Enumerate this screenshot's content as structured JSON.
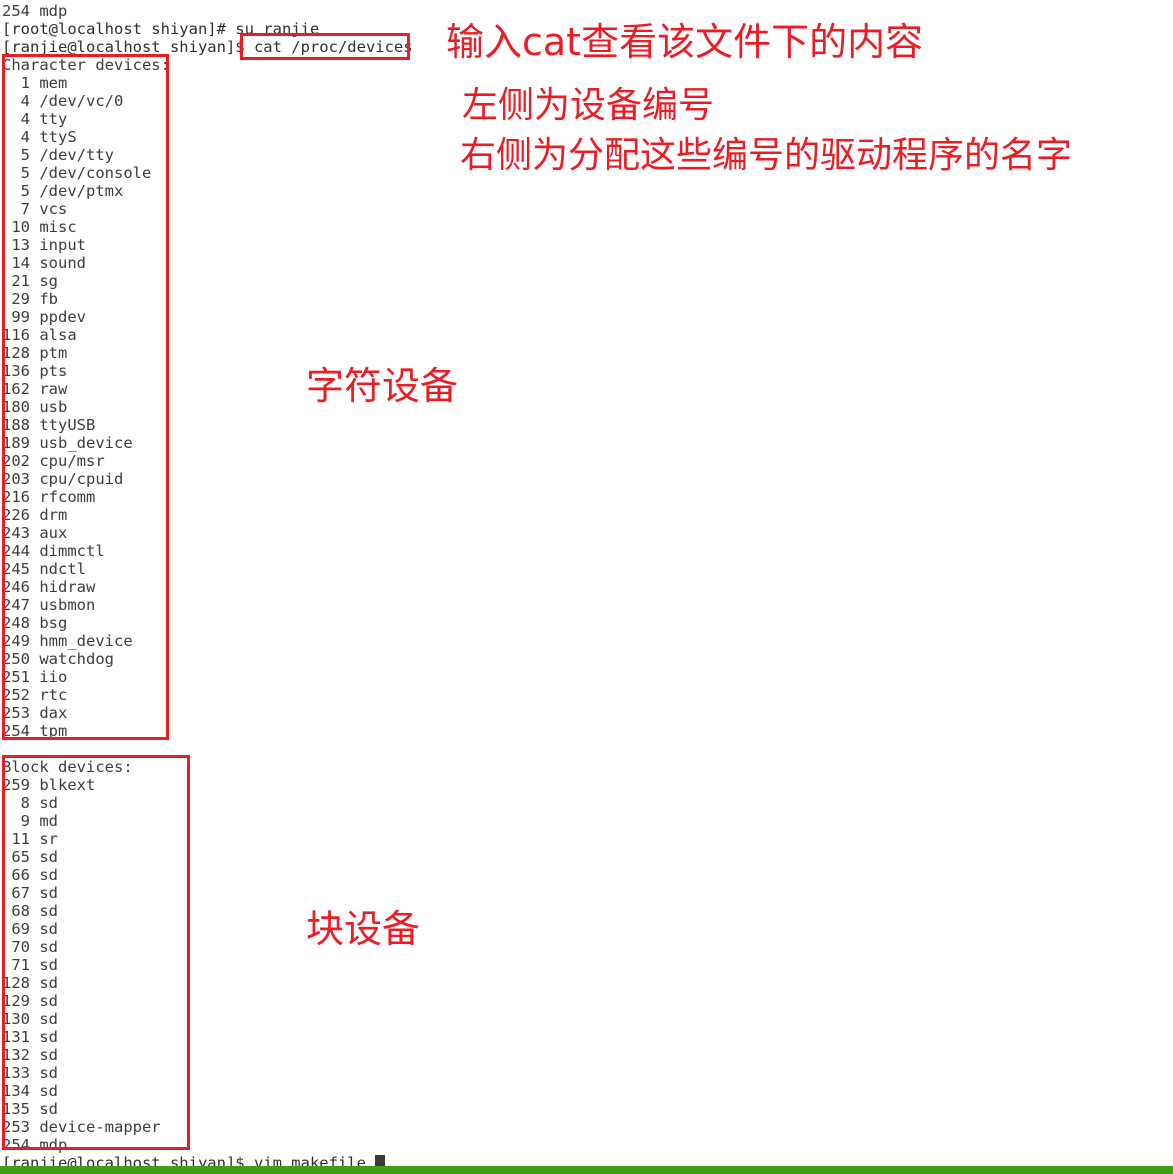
{
  "terminal": {
    "scrollback_top_line": "254 mdp",
    "prompt_lines": [
      {
        "prompt": "[root@localhost shiyan]# ",
        "command": "su ranjie"
      },
      {
        "prompt": "[ranjie@localhost shiyan]$ ",
        "command": "cat /proc/devices"
      }
    ],
    "bottom_prompt": {
      "prompt": "[ranjie@localhost shiyan]$ ",
      "command": "vim makefile",
      "cursor": "block"
    },
    "character_devices": {
      "heading": "Character devices:",
      "entries": [
        {
          "major": "1",
          "name": "mem"
        },
        {
          "major": "4",
          "name": "/dev/vc/0"
        },
        {
          "major": "4",
          "name": "tty"
        },
        {
          "major": "4",
          "name": "ttyS"
        },
        {
          "major": "5",
          "name": "/dev/tty"
        },
        {
          "major": "5",
          "name": "/dev/console"
        },
        {
          "major": "5",
          "name": "/dev/ptmx"
        },
        {
          "major": "7",
          "name": "vcs"
        },
        {
          "major": "10",
          "name": "misc"
        },
        {
          "major": "13",
          "name": "input"
        },
        {
          "major": "14",
          "name": "sound"
        },
        {
          "major": "21",
          "name": "sg"
        },
        {
          "major": "29",
          "name": "fb"
        },
        {
          "major": "99",
          "name": "ppdev"
        },
        {
          "major": "116",
          "name": "alsa"
        },
        {
          "major": "128",
          "name": "ptm"
        },
        {
          "major": "136",
          "name": "pts"
        },
        {
          "major": "162",
          "name": "raw"
        },
        {
          "major": "180",
          "name": "usb"
        },
        {
          "major": "188",
          "name": "ttyUSB"
        },
        {
          "major": "189",
          "name": "usb_device"
        },
        {
          "major": "202",
          "name": "cpu/msr"
        },
        {
          "major": "203",
          "name": "cpu/cpuid"
        },
        {
          "major": "216",
          "name": "rfcomm"
        },
        {
          "major": "226",
          "name": "drm"
        },
        {
          "major": "243",
          "name": "aux"
        },
        {
          "major": "244",
          "name": "dimmctl"
        },
        {
          "major": "245",
          "name": "ndctl"
        },
        {
          "major": "246",
          "name": "hidraw"
        },
        {
          "major": "247",
          "name": "usbmon"
        },
        {
          "major": "248",
          "name": "bsg"
        },
        {
          "major": "249",
          "name": "hmm_device"
        },
        {
          "major": "250",
          "name": "watchdog"
        },
        {
          "major": "251",
          "name": "iio"
        },
        {
          "major": "252",
          "name": "rtc"
        },
        {
          "major": "253",
          "name": "dax"
        },
        {
          "major": "254",
          "name": "tpm"
        }
      ]
    },
    "block_devices": {
      "heading": "Block devices:",
      "entries": [
        {
          "major": "259",
          "name": "blkext"
        },
        {
          "major": "8",
          "name": "sd"
        },
        {
          "major": "9",
          "name": "md"
        },
        {
          "major": "11",
          "name": "sr"
        },
        {
          "major": "65",
          "name": "sd"
        },
        {
          "major": "66",
          "name": "sd"
        },
        {
          "major": "67",
          "name": "sd"
        },
        {
          "major": "68",
          "name": "sd"
        },
        {
          "major": "69",
          "name": "sd"
        },
        {
          "major": "70",
          "name": "sd"
        },
        {
          "major": "71",
          "name": "sd"
        },
        {
          "major": "128",
          "name": "sd"
        },
        {
          "major": "129",
          "name": "sd"
        },
        {
          "major": "130",
          "name": "sd"
        },
        {
          "major": "131",
          "name": "sd"
        },
        {
          "major": "132",
          "name": "sd"
        },
        {
          "major": "133",
          "name": "sd"
        },
        {
          "major": "134",
          "name": "sd"
        },
        {
          "major": "135",
          "name": "sd"
        },
        {
          "major": "253",
          "name": "device-mapper"
        },
        {
          "major": "254",
          "name": "mdp"
        }
      ]
    }
  },
  "annotations": {
    "command_note": "输入cat查看该文件下的内容",
    "left_note": "左侧为设备编号",
    "right_note": "右侧为分配这些编号的驱动程序的名字",
    "char_label": "字符设备",
    "block_label": "块设备"
  },
  "colors": {
    "annotation_red": "#ED1C24",
    "terminal_text": "#3b3b3b",
    "background": "#ffffff",
    "taskbar_green": "#3f9f16"
  }
}
